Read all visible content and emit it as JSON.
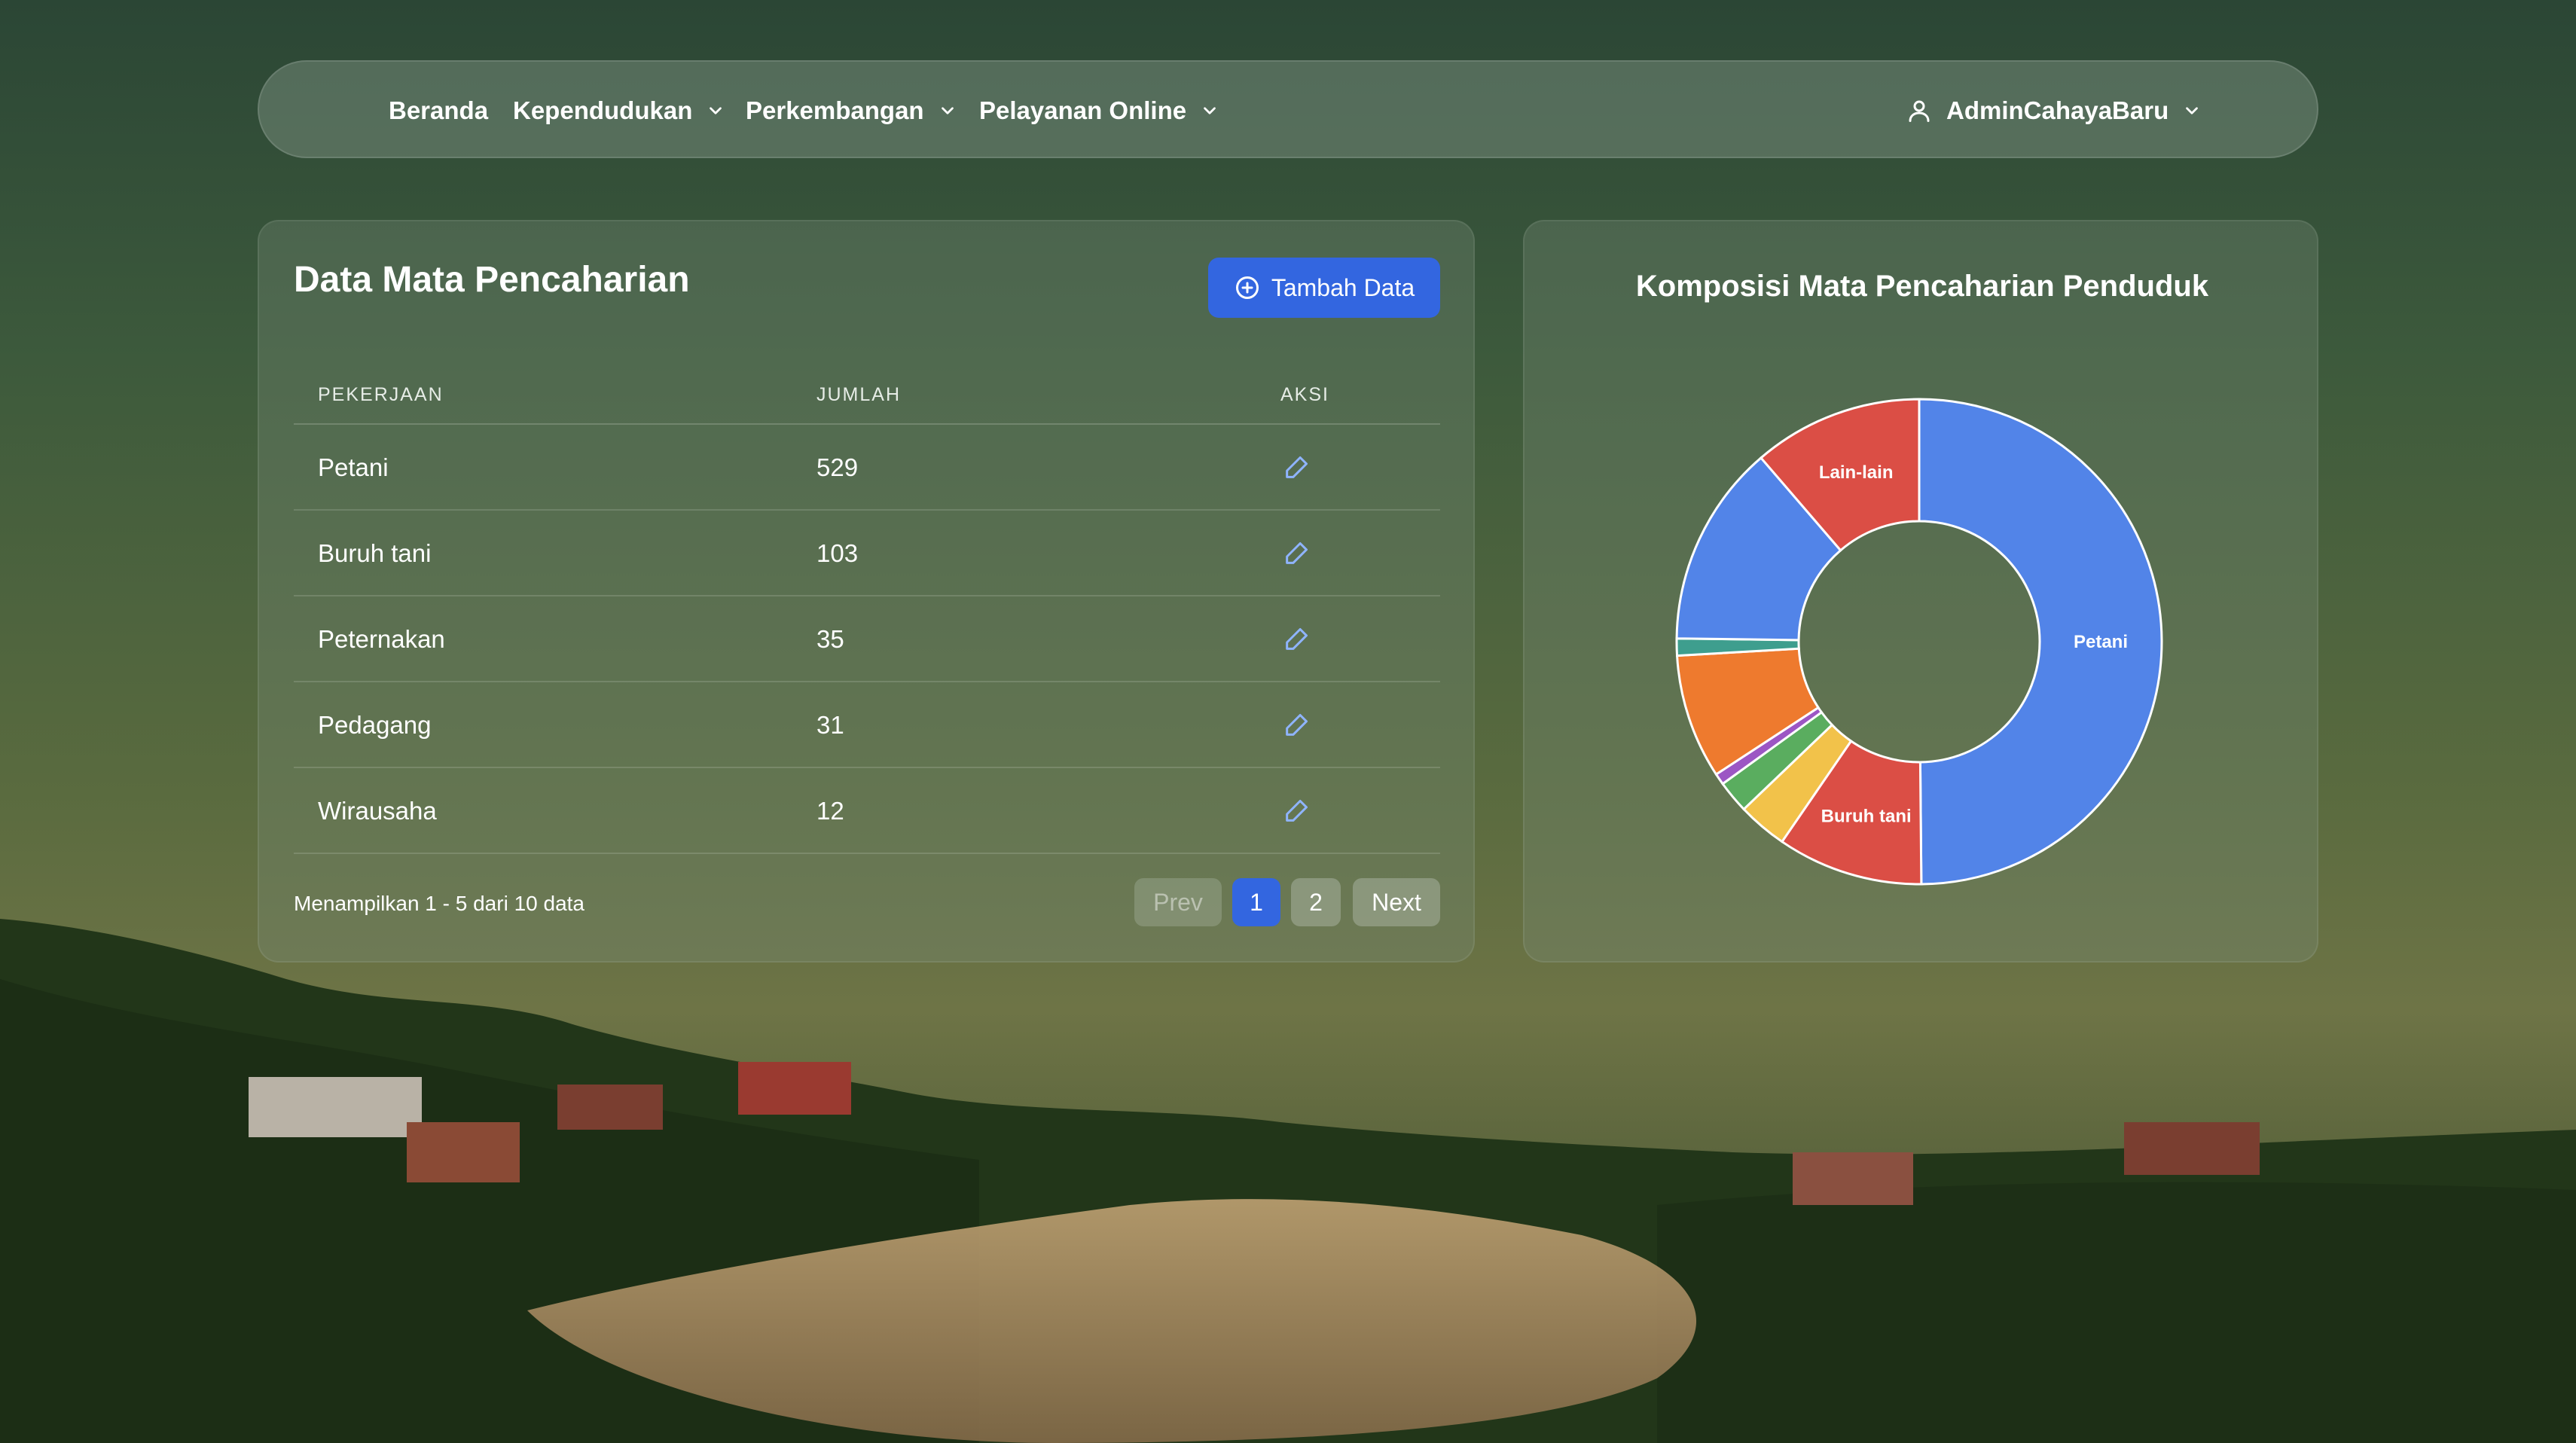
{
  "nav": {
    "items": [
      {
        "label": "Beranda",
        "dropdown": false
      },
      {
        "label": "Kependudukan",
        "dropdown": true
      },
      {
        "label": "Perkembangan",
        "dropdown": true
      },
      {
        "label": "Pelayanan Online",
        "dropdown": true
      }
    ],
    "user": {
      "label": "AdminCahayaBaru",
      "icon": "user-icon"
    }
  },
  "table_panel": {
    "title": "Data Mata Pencaharian",
    "add_button": {
      "label": "Tambah Data",
      "icon": "plus-circle-icon"
    },
    "columns": [
      "PEKERJAAN",
      "JUMLAH",
      "AKSI"
    ],
    "rows": [
      {
        "pekerjaan": "Petani",
        "jumlah": "529",
        "action_icon": "pencil-icon"
      },
      {
        "pekerjaan": "Buruh tani",
        "jumlah": "103",
        "action_icon": "pencil-icon"
      },
      {
        "pekerjaan": "Peternakan",
        "jumlah": "35",
        "action_icon": "pencil-icon"
      },
      {
        "pekerjaan": "Pedagang",
        "jumlah": "31",
        "action_icon": "pencil-icon"
      },
      {
        "pekerjaan": "Wirausaha",
        "jumlah": "12",
        "action_icon": "pencil-icon"
      }
    ],
    "footer_text": "Menampilkan 1 - 5 dari 10 data",
    "pagination": {
      "prev": "Prev",
      "pages": [
        "1",
        "2"
      ],
      "current": "1",
      "next": "Next"
    }
  },
  "chart_panel": {
    "title": "Komposisi Mata Pencaharian Penduduk"
  },
  "chart_data": {
    "type": "pie",
    "donut": true,
    "title": "Komposisi Mata Pencaharian Penduduk",
    "slices": [
      {
        "label": "Petani",
        "value": 529,
        "color": "#5284e8",
        "show_label": true
      },
      {
        "label": "Buruh tani",
        "value": 103,
        "color": "#db4e45",
        "show_label": true
      },
      {
        "label": "",
        "value": 35,
        "color": "#f2c24a",
        "show_label": false
      },
      {
        "label": "",
        "value": 23,
        "color": "#5aad5f",
        "show_label": false
      },
      {
        "label": "",
        "value": 8,
        "color": "#9c56c4",
        "show_label": false
      },
      {
        "label": "",
        "value": 88,
        "color": "#ee7a2e",
        "show_label": false
      },
      {
        "label": "",
        "value": 12,
        "color": "#3e9e8e",
        "show_label": false
      },
      {
        "label": "",
        "value": 143,
        "color": "#5284e8",
        "show_label": false
      },
      {
        "label": "Lain-lain",
        "value": 120,
        "color": "#db4e45",
        "show_label": true
      }
    ]
  },
  "colors": {
    "accent": "#3366e0",
    "edit_icon": "#8fb4ff"
  }
}
